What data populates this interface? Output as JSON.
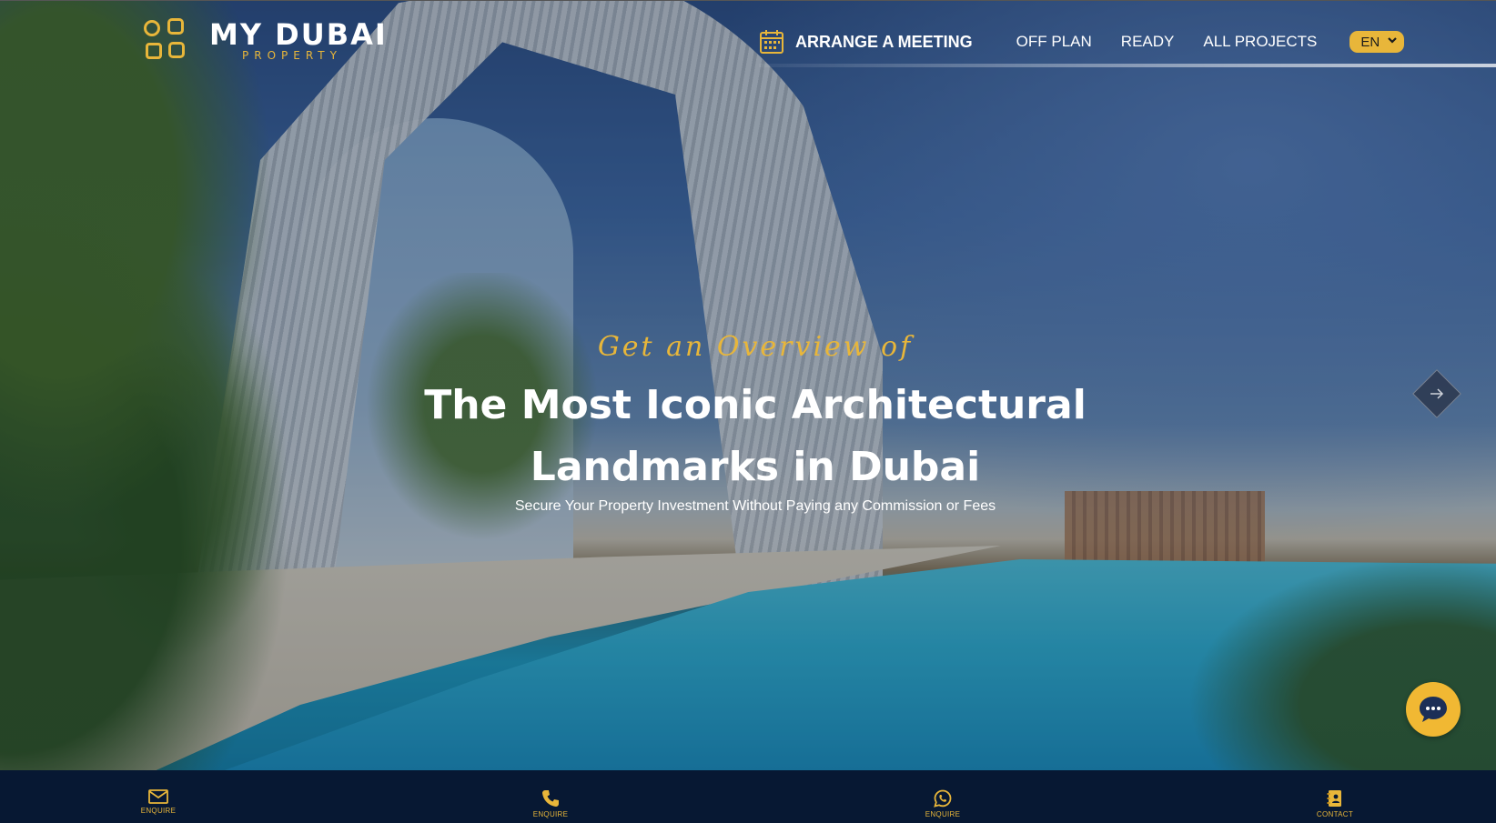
{
  "header": {
    "logo_main": "MY DUBAI",
    "logo_sub": "PROPERTY",
    "arrange_meeting": "ARRANGE A MEETING",
    "nav": [
      "OFF PLAN",
      "READY",
      "ALL PROJECTS"
    ],
    "language": "EN"
  },
  "hero": {
    "tagline": "Get an Overview of",
    "headline_line1": "The Most Iconic Architectural",
    "headline_line2": "Landmarks in Dubai",
    "subline": "Secure Your Property Investment Without Paying any Commission or Fees"
  },
  "bottom_bar": [
    {
      "label": "ENQUIRE",
      "icon": "mail-icon"
    },
    {
      "label": "ENQUIRE",
      "icon": "phone-icon"
    },
    {
      "label": "ENQUIRE",
      "icon": "whatsapp-icon"
    },
    {
      "label": "CONTACT",
      "icon": "contact-book-icon"
    }
  ],
  "colors": {
    "accent": "#e8b63a",
    "bar": "#071833",
    "chat": "#f1b833"
  }
}
